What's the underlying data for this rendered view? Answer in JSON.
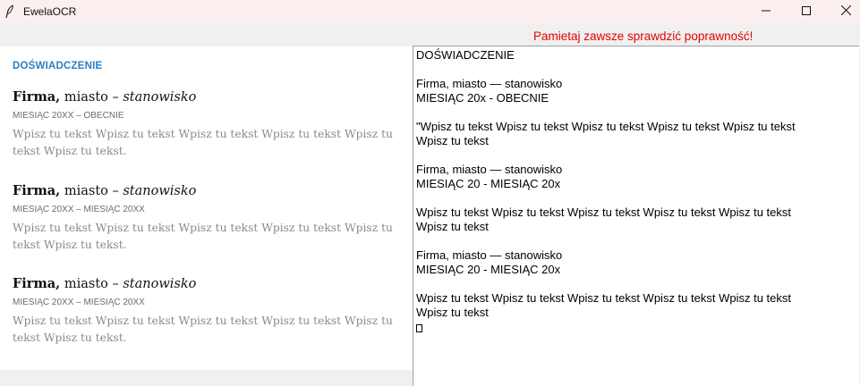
{
  "window": {
    "title": "EwelaOCR",
    "app_icon": "feather-icon",
    "controls": [
      "minimize-icon",
      "maximize-icon",
      "close-icon"
    ]
  },
  "warning": "Pamietaj zawsze sprawdzić poprawność!",
  "preview": {
    "section_heading": "DOŚWIADCZENIE",
    "entries": [
      {
        "company": "Firma,",
        "city": " miasto – ",
        "position": "stanowisko",
        "date": "MIESIĄC 20XX – OBECNIE",
        "text": "Wpisz tu tekst Wpisz tu tekst Wpisz tu tekst Wpisz tu tekst Wpisz tu tekst Wpisz tu tekst."
      },
      {
        "company": "Firma,",
        "city": " miasto – ",
        "position": "stanowisko",
        "date": "MIESIĄC 20XX – MIESIĄC 20XX",
        "text": "Wpisz tu tekst Wpisz tu tekst Wpisz tu tekst Wpisz tu tekst Wpisz tu tekst Wpisz tu tekst."
      },
      {
        "company": "Firma,",
        "city": " miasto – ",
        "position": "stanowisko",
        "date": "MIESIĄC 20XX – MIESIĄC 20XX",
        "text": "Wpisz tu tekst Wpisz tu tekst Wpisz tu tekst Wpisz tu tekst Wpisz tu tekst Wpisz tu tekst."
      }
    ]
  },
  "ocr_output": {
    "lines": [
      "DOŚWIADCZENIE",
      "",
      "Firma, miasto — stanowisko",
      "MIESIĄC 20x - OBECNIE",
      "",
      "\"Wpisz tu tekst Wpisz tu tekst Wpisz tu tekst Wpisz tu tekst Wpisz tu tekst",
      "Wpisz tu tekst",
      "",
      "Firma, miasto — stanowisko",
      "MIESIĄC 20 - MIESIĄC 20x",
      "",
      "Wpisz tu tekst Wpisz tu tekst Wpisz tu tekst Wpisz tu tekst Wpisz tu tekst",
      "Wpisz tu tekst",
      "",
      "Firma, miasto — stanowisko",
      "MIESIĄC 20 - MIESIĄC 20x",
      "",
      "Wpisz tu tekst Wpisz tu tekst Wpisz tu tekst Wpisz tu tekst Wpisz tu tekst",
      "Wpisz tu tekst"
    ]
  },
  "colors": {
    "titlebar": "#fbefef",
    "warning": "#e60000",
    "heading_accent": "#2a7fc4"
  }
}
